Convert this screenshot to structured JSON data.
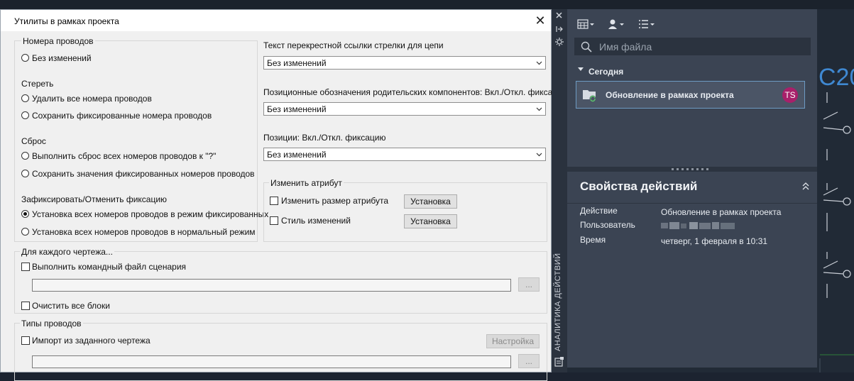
{
  "dialog": {
    "title": "Утилиты в рамках проекта",
    "close_glyph": "✕",
    "wire_numbers": {
      "group_label": "Номера проводов",
      "option": "Без изменений"
    },
    "erase": {
      "label": "Стереть",
      "option1": "Удалить все номера проводов",
      "option2": "Сохранить фиксированные номера проводов"
    },
    "reset": {
      "label": "Сброс",
      "option1": "Выполнить сброс всех номеров проводов к \"?\"",
      "option2": "Сохранить значения фиксированных номеров проводов"
    },
    "fix": {
      "label": "Зафиксировать/Отменить фиксацию",
      "option1": "Установка всех номеров проводов в режим фиксированных",
      "option2": "Установка всех номеров проводов в нормальный режим"
    },
    "cross_ref": {
      "label": "Текст перекрестной ссылки стрелки для цепи",
      "value": "Без изменений"
    },
    "parent_tags": {
      "label": "Позиционные обозначения родительских компонентов: Вкл./Откл. фиксацию",
      "value": "Без изменений"
    },
    "positions": {
      "label": "Позиции: Вкл./Откл. фиксацию",
      "value": "Без изменений"
    },
    "change_attr": {
      "group_label": "Изменить атрибут",
      "size_label": "Изменить размер атрибута",
      "size_button": "Установка",
      "style_label": "Стиль изменений",
      "style_button": "Установка"
    },
    "per_drawing": {
      "group_label": "Для каждого чертежа...",
      "script_label": "Выполнить командный файл сценария",
      "browse1": "...",
      "purge_label": "Очистить все блоки"
    },
    "wire_types": {
      "group_label": "Типы проводов",
      "import_label": "Импорт из заданного чертежа",
      "setup_button": "Настройка",
      "browse2": "..."
    }
  },
  "panel": {
    "search_placeholder": "Имя файла",
    "section_today": "Сегодня",
    "file_item": "Обновление в рамках проекта",
    "avatar_initials": "TS",
    "props_title": "Свойства действий",
    "action_label": "Действие",
    "action_value": "Обновление в рамках проекта",
    "user_label": "Пользователь",
    "time_label": "Время",
    "time_value": "четверг, 1 февраля в 10:31",
    "vertical_tab": "АНАЛИТИКА ДЕЙСТВИЙ"
  },
  "colors": {
    "accent_border": "#6d9bc3",
    "avatar": "#a8206a",
    "panel_bg": "#3b4453"
  }
}
